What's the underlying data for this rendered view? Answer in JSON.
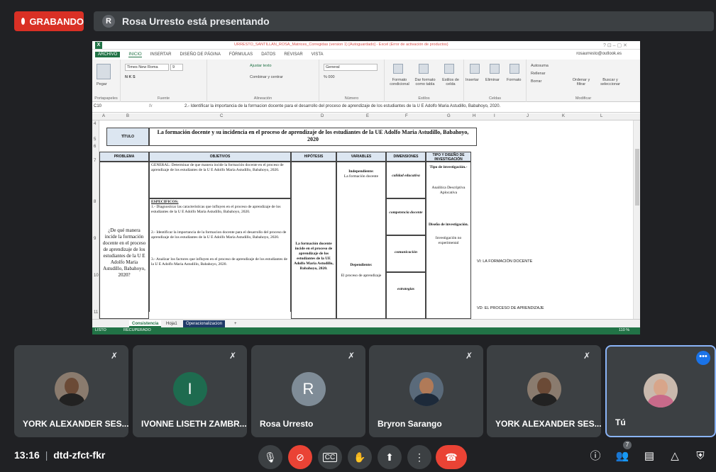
{
  "meet": {
    "recording_label": "GRABANDO",
    "presenter_initial": "R",
    "presenting_text": "Rosa Urresto está presentando",
    "time": "13:16",
    "separator": "|",
    "meeting_code": "dtd-zfct-fkr",
    "participant_count": "7",
    "colors": {
      "bg": "#202124",
      "tile": "#3c4043",
      "red": "#ea4335",
      "accent": "#1a73e8"
    }
  },
  "participants": [
    {
      "name": "YORK ALEXANDER SES...",
      "avatar": "photo",
      "muted": true
    },
    {
      "name": "IVONNE LISETH ZAMBR...",
      "avatar": "I",
      "avatar_color": "#1e6b4f",
      "muted": true
    },
    {
      "name": "Rosa Urresto",
      "avatar": "R",
      "avatar_color": "#7f8c97",
      "muted": true
    },
    {
      "name": "Bryron Sarango",
      "avatar": "photo",
      "muted": true
    },
    {
      "name": "YORK ALEXANDER SES...",
      "avatar": "photo",
      "muted": true
    },
    {
      "name": "Tú",
      "avatar": "photo",
      "muted": false,
      "more_label": "•••"
    }
  ],
  "excel": {
    "title": "URRESTO_SANTILLAN_ROSA_Matrices_Corregidas (version 1) [Autoguardado] - Excel (Error de activación de productos)",
    "app_icon": "X",
    "window_controls": "?   ⊡  –  ▢  ✕",
    "account": "rosaurresto@outlook.es",
    "menus": [
      "ARCHIVO",
      "INICIO",
      "INSERTAR",
      "DISEÑO DE PÁGINA",
      "FÓRMULAS",
      "DATOS",
      "REVISAR",
      "VISTA"
    ],
    "ribbon": {
      "paste": "Pegar",
      "font_name": "Times New Roma",
      "font_size": "9",
      "wrap_text": "Ajustar texto",
      "merge": "Combinar y centrar",
      "number_format": "General",
      "cond_format": "Formato condicional",
      "format_table": "Dar formato como tabla",
      "cell_styles": "Estilos de celda",
      "insert": "Insertar",
      "delete": "Eliminar",
      "format": "Formato",
      "autosum": "Autosuma",
      "fill": "Rellenar",
      "clear": "Borrar",
      "sort": "Ordenar y filtrar",
      "find": "Buscar y seleccionar",
      "groups": [
        "Portapapeles",
        "Fuente",
        "Alineación",
        "Número",
        "Estilos",
        "Celdas",
        "Modificar"
      ],
      "font_buttons": "N  K  S",
      "percent": "% 000"
    },
    "name_box": "C10",
    "fx": "fx",
    "formula": "2.- Identificar la importancia de la formacion docente para el desarrollo del proceso de aprendizaje  de los estudiantes de la U E Adolfo Maria Astudillo, Babahoyo, 2020.",
    "columns": [
      "A",
      "B",
      "C",
      "D",
      "E",
      "F",
      "G",
      "H",
      "I",
      "J",
      "K",
      "L"
    ],
    "rows": [
      "4",
      "5",
      "6",
      "7",
      "8",
      "9",
      "10",
      "11"
    ],
    "cells": {
      "titulo_label": "TÍTULO",
      "titulo": "La formación docente y su incidencia en el proceso de aprendizaje de los estudiantes de la UE Adolfo Maria Astudillo, Babahoyo, 2020",
      "h_problema": "PROBLEMA",
      "h_objetivos": "OBJETIVOS",
      "h_hipotesis": "HIPÓTESIS",
      "h_variables": "VARIABLES",
      "h_dimensiones": "DIMENSIONES",
      "h_tipo": "TIPO Y DISEÑO DE INVESTIGACIÓN",
      "problema": "¿De qué manera incide la formación docente en el proceso de aprendizaje de los estudiantes de la U E Adolfo Maria Astudillo, Babahoyo, 2020?",
      "obj_general": "GENERAL: Determinar de que manera incide la formación docente en el proceso de aprendizaje de los estudiantes de la U E Adolfo Maria Astudillo, Babahoyo, 2020.",
      "obj_especificos": "ESPECIFICOS:",
      "obj_1": "1.- Diagnosticar las caracteristicas que influyen en el proceso de aprendizaje de los estudiantes de la U E Adolfo Maria Astudillo, Babahoyo, 2020.",
      "obj_2": "2.- Identificar la importancia de la formacion docente para el desarrollo del proceso de aprendizaje  de los estudiantes de la U E Adolfo Maria Astudillo, Babahoyo, 2020.",
      "obj_3": "3.- Analizar los factores que influyen en el proceso de aprendizaje de los estudiantes de la U E Adolfo Maria Astudillo, Babahoyo, 2020.",
      "hipotesis": "La formación docente incide en el proceso de aprendizaje de los estudiantes de la UE Adolfo Maria Astudillo, Babahoyo, 2020.",
      "var_indep_label": "Independiente:",
      "var_indep": "La formación docente",
      "var_dep_label": "Dependiente:",
      "var_dep": "El proceso de aprendizaje",
      "dim_1": "calidad educativa",
      "dim_2": "competencia docente",
      "dim_3": "comunicación",
      "dim_4": "estrategias",
      "tipo_label": "Tipo de investigación.-",
      "tipo": "Analítica Descriptiva Aplocativa",
      "diseno_label": "Diseño de investigación.",
      "diseno": "Investigación no experimental",
      "vi_note": "VI: LA FORMACIÓN DOCENTE",
      "vd_note": "VD: EL PROCESO DE APRENDIZAJE"
    },
    "sheets": [
      "Consistencia",
      "Hoja1",
      "Operacionalizacion"
    ],
    "add_sheet": "+",
    "status_ready": "LISTO",
    "status_recovered": "RECUPERADO",
    "zoom": "110 %",
    "colors": {
      "green": "#217346",
      "header_fill": "#dce6f1"
    }
  }
}
